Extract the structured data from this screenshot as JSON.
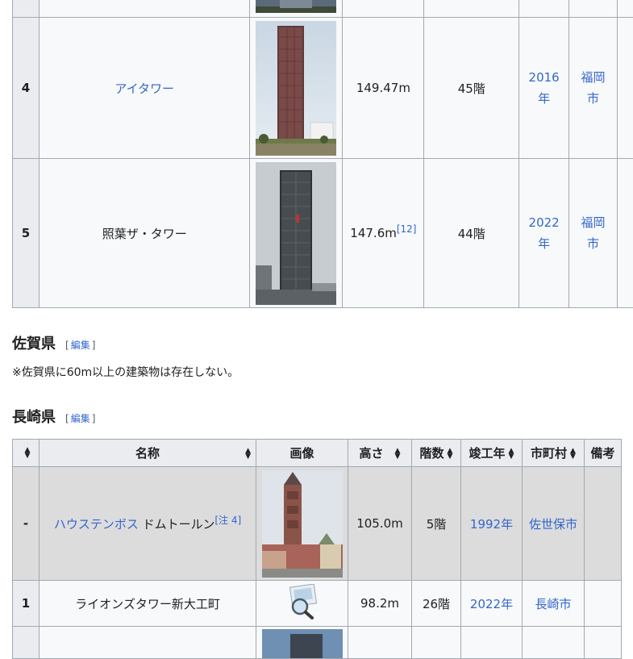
{
  "fukuoka_table": {
    "rows": [
      {
        "rank": "4",
        "name": "アイタワー",
        "name_is_link": true,
        "height": "149.47m",
        "height_ref": "",
        "floors": "45階",
        "year_l1": "2016",
        "year_l2": "年",
        "city_l1": "福岡",
        "city_l2": "市"
      },
      {
        "rank": "5",
        "name": "照葉ザ・タワー",
        "name_is_link": false,
        "height": "147.6m",
        "height_ref": "[12]",
        "floors": "44階",
        "year_l1": "2022",
        "year_l2": "年",
        "city_l1": "福岡",
        "city_l2": "市"
      }
    ]
  },
  "saga_section": {
    "heading": "佐賀県",
    "edit_open": "[",
    "edit_label": "編集",
    "edit_close": "]",
    "note": "※佐賀県に60m以上の建築物は存在しない。"
  },
  "nagasaki_section": {
    "heading": "長崎県",
    "edit_open": "[",
    "edit_label": "編集",
    "edit_close": "]"
  },
  "nagasaki_table": {
    "headers": {
      "name": "名称",
      "image": "画像",
      "height": "高さ",
      "floors": "階数",
      "year": "竣工年",
      "city": "市町村",
      "notes": "備考"
    },
    "sort_icon": "sort-arrows-icon",
    "rows": [
      {
        "rank": "-",
        "name_link": "ハウステンボス",
        "name_rest": " ドムトールン",
        "name_ref": "[注 4]",
        "height": "105.0m",
        "floors": "5階",
        "year": "1992年",
        "city": "佐世保市",
        "notes": ""
      },
      {
        "rank": "1",
        "name_link": "",
        "name_rest": "ライオンズタワー新大工町",
        "name_ref": "",
        "height": "98.2m",
        "floors": "26階",
        "year": "2022年",
        "city": "長崎市",
        "notes": ""
      }
    ]
  }
}
